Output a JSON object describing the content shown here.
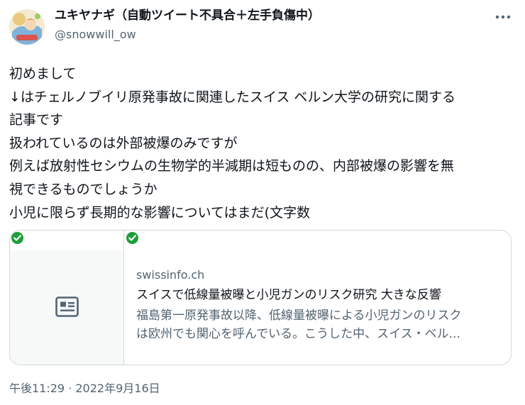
{
  "author": {
    "display_name": "ユキヤナギ（自動ツイート不具合＋左手負傷中）",
    "handle": "@snowwill_ow"
  },
  "tweet": {
    "lines": [
      "初めまして",
      "↓はチェルノブイリ原発事故に関連したスイス ベルン大学の研究に関する",
      "記事です",
      "扱われているのは外部被爆のみですが",
      "例えば放射性セシウムの生物学的半減期は短ものの、内部被爆の影響を無",
      "視できるものでしょうか",
      "小児に限らず長期的な影響についてはまだ(文字数"
    ]
  },
  "link_card": {
    "domain": "swissinfo.ch",
    "title": "スイスで低線量被曝と小児ガンのリスク研究 大きな反響",
    "description_lines": [
      "福島第一原発事故以降、低線量被曝による小児ガンのリスク",
      "は欧州でも関心を呼んでいる。こうした中、スイス・ベル..."
    ],
    "thumbnail_icon": "article-icon",
    "badge_icon": "check-badge-icon"
  },
  "meta": {
    "timestamp": "午後11:29 · 2022年9月16日"
  },
  "colors": {
    "text_primary": "#0f1419",
    "text_secondary": "#536471",
    "border": "#cfd9de",
    "badge_green": "#1e9e3a"
  }
}
